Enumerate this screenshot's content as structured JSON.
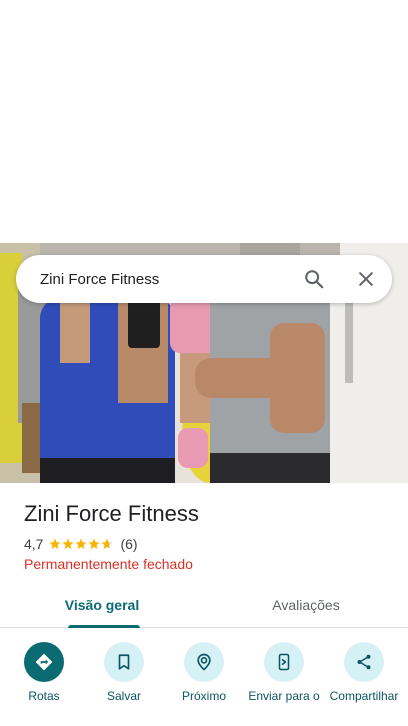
{
  "search": {
    "query": "Zini Force Fitness",
    "search_icon": "search-icon",
    "clear_icon": "close-icon"
  },
  "place": {
    "name": "Zini Force Fitness",
    "rating": "4,7",
    "rating_value": 4.7,
    "review_count": "(6)",
    "status": "Permanentemente fechado"
  },
  "tabs": [
    {
      "label": "Visão geral",
      "active": true
    },
    {
      "label": "Avaliações",
      "active": false
    }
  ],
  "actions": [
    {
      "label": "Rotas",
      "icon": "directions-icon"
    },
    {
      "label": "Salvar",
      "icon": "bookmark-icon"
    },
    {
      "label": "Próximo",
      "icon": "nearby-icon"
    },
    {
      "label": "Enviar para o",
      "icon": "send-to-phone-icon"
    },
    {
      "label": "Compartilhar",
      "icon": "share-icon"
    }
  ],
  "colors": {
    "accent": "#0b6b73",
    "accent_light": "#d6f1f5",
    "closed_red": "#d93025",
    "star": "#f4b400"
  }
}
